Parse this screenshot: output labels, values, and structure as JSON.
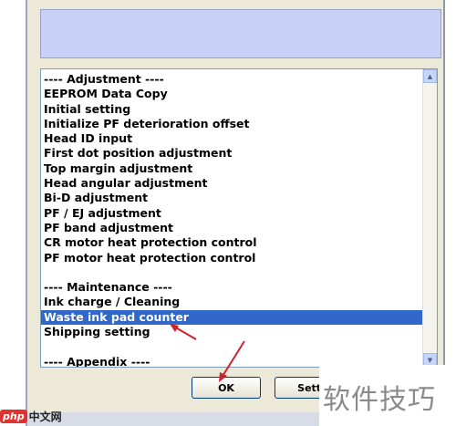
{
  "list": {
    "items": [
      "---- Adjustment ----",
      "EEPROM Data Copy",
      "Initial setting",
      "Initialize PF deterioration offset",
      "Head ID input",
      "First dot position adjustment",
      "Top margin adjustment",
      "Head angular adjustment",
      "Bi-D adjustment",
      "PF / EJ adjustment",
      "PF band adjustment",
      "CR motor heat protection control",
      "PF motor heat protection control",
      "",
      "---- Maintenance ----",
      "Ink charge / Cleaning",
      "Waste ink pad counter",
      "Shipping setting",
      "",
      "---- Appendix ----"
    ],
    "selected": "Waste ink pad counter"
  },
  "buttons": {
    "ok_label": "OK",
    "settings_label": "Setti"
  },
  "watermark": {
    "text": "软件技巧",
    "logo_badge": "php",
    "logo_text": "中文网"
  },
  "colors": {
    "selection": "#3167c8",
    "info_panel": "#c8d0f8",
    "arrow": "#d0202a"
  }
}
